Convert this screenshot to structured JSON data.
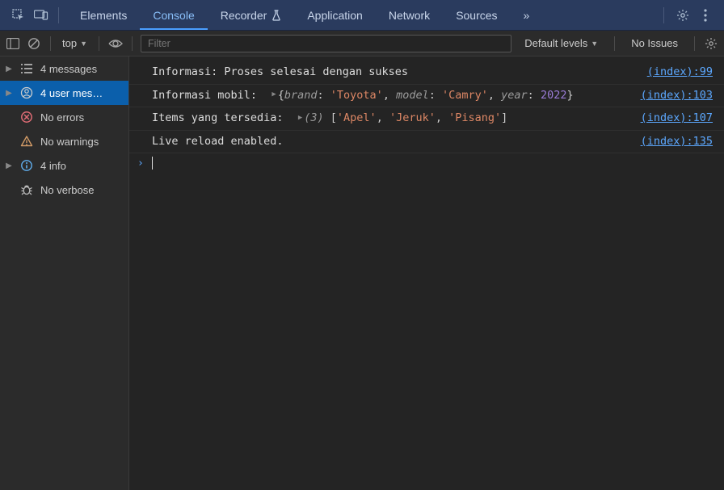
{
  "topbar": {
    "tabs": [
      {
        "label": "Elements",
        "active": false
      },
      {
        "label": "Console",
        "active": true
      },
      {
        "label": "Recorder",
        "active": false,
        "flask": true
      },
      {
        "label": "Application",
        "active": false
      },
      {
        "label": "Network",
        "active": false
      },
      {
        "label": "Sources",
        "active": false
      }
    ],
    "more": "»"
  },
  "subbar": {
    "context": "top",
    "filter_placeholder": "Filter",
    "levels": "Default levels",
    "issues": "No Issues"
  },
  "sidebar": {
    "items": [
      {
        "label": "4 messages",
        "icon": "list",
        "expandable": true,
        "selected": false
      },
      {
        "label": "4 user mes…",
        "icon": "user",
        "expandable": true,
        "selected": true
      },
      {
        "label": "No errors",
        "icon": "error",
        "expandable": false,
        "selected": false
      },
      {
        "label": "No warnings",
        "icon": "warn",
        "expandable": false,
        "selected": false
      },
      {
        "label": "4 info",
        "icon": "info",
        "expandable": true,
        "selected": false
      },
      {
        "label": "No verbose",
        "icon": "bug",
        "expandable": false,
        "selected": false
      }
    ]
  },
  "console": {
    "rows": [
      {
        "type": "text",
        "text": "Informasi: Proses selesai dengan sukses",
        "src": "(index):99"
      },
      {
        "type": "object",
        "label": "Informasi mobil: ",
        "obj": {
          "brand": "Toyota",
          "model": "Camry",
          "year": 2022
        },
        "src": "(index):103"
      },
      {
        "type": "array",
        "label": "Items yang tersedia: ",
        "count": 3,
        "arr": [
          "Apel",
          "Jeruk",
          "Pisang"
        ],
        "src": "(index):107"
      },
      {
        "type": "text",
        "text": "Live reload enabled.",
        "src": "(index):135"
      }
    ],
    "prompt": "›"
  }
}
